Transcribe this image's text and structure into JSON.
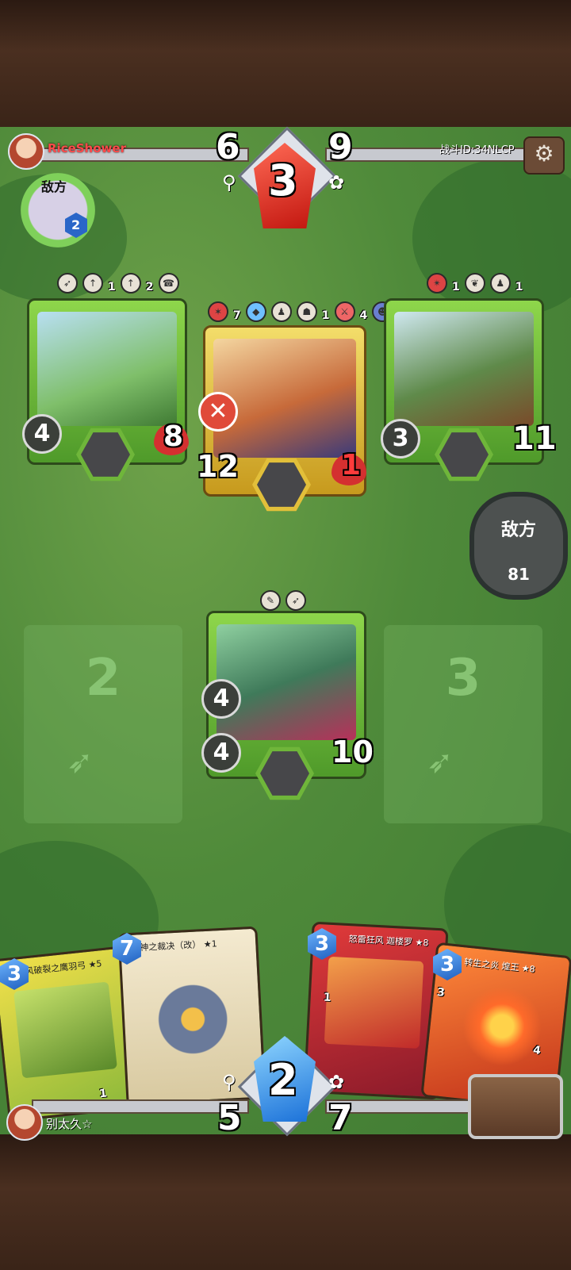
{
  "top": {
    "opponent_name": "RiceShower",
    "battle_id": "战斗ID:34NLCP",
    "enemy_label": "敌方",
    "enemy_level": "2",
    "left_count": "6",
    "center_gem": "3",
    "right_count": "9"
  },
  "enemy_cards": [
    {
      "attack": "4",
      "health": "8",
      "badges": [
        "1",
        "2"
      ]
    },
    {
      "attack": "12",
      "health": "1",
      "badges": [
        "7",
        "1",
        "4"
      ]
    },
    {
      "attack": "3",
      "health": "11",
      "badges": [
        "1",
        "1"
      ]
    }
  ],
  "side_button": {
    "label": "敌方",
    "count": "81"
  },
  "player_field": {
    "slot_left": "2",
    "slot_right": "3",
    "card": {
      "attack": "4",
      "defense": "4",
      "health": "10"
    }
  },
  "hand": [
    {
      "cost": "3",
      "title": "疾风破裂之鹰羽弓 ★5",
      "badge": "1"
    },
    {
      "cost": "7",
      "title": "神之裁决（改） ★1"
    },
    {
      "cost": "3",
      "title": "怒雷狂风 迦楼罗 ★8",
      "badge": "1"
    },
    {
      "cost": "3",
      "title": "转生之炎 煌王 ★8",
      "badge": "3",
      "badge2": "4"
    }
  ],
  "bottom": {
    "player_name": "别太久☆",
    "left_count": "5",
    "center_gem": "2",
    "right_count": "7"
  },
  "colors": {
    "enemy_name": "#ff4a4a",
    "frame_green": "#6fb63a",
    "frame_gold": "#e2bf3a",
    "health_red": "#d43030"
  }
}
